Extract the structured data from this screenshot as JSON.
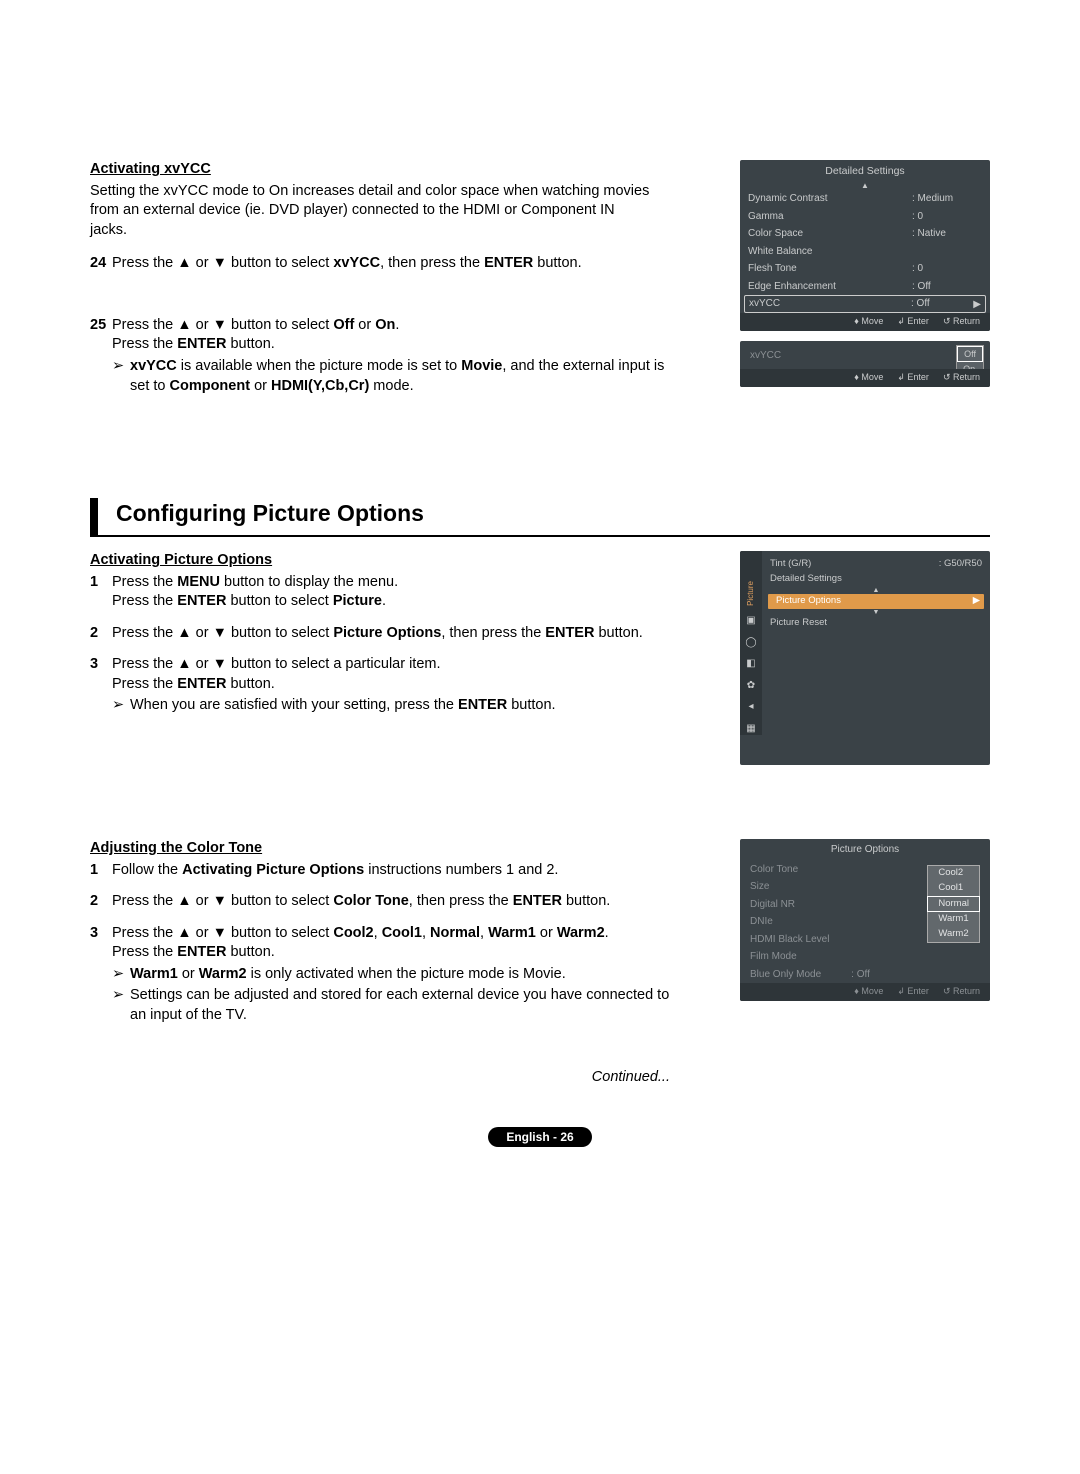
{
  "xvycc": {
    "heading": "Activating xvYCC",
    "intro": "Setting the xvYCC mode to On increases detail and color space when watching movies from an external device (ie. DVD player) connected to the HDMI or Component IN jacks.",
    "step24_num": "24",
    "step24_a": "Press the ▲ or ▼ button to select ",
    "step24_b": "xvYCC",
    "step24_c": ", then press the ",
    "step24_d": "ENTER",
    "step24_e": " button.",
    "step25_num": "25",
    "step25_line1_a": "Press the ▲ or ▼ button to select ",
    "step25_line1_b": "Off",
    "step25_line1_c": " or ",
    "step25_line1_d": "On",
    "step25_line1_e": ".",
    "step25_line2_a": "Press the ",
    "step25_line2_b": "ENTER",
    "step25_line2_c": " button.",
    "step25_note_a": "xvYCC",
    "step25_note_b": " is available when the picture mode is set to ",
    "step25_note_c": "Movie",
    "step25_note_d": ", and the external input is set to ",
    "step25_note_e": "Component",
    "step25_note_f": " or ",
    "step25_note_g": "HDMI(Y,Cb,Cr)",
    "step25_note_h": " mode."
  },
  "config": {
    "title": "Configuring Picture Options",
    "act_heading": "Activating Picture Options",
    "step1_num": "1",
    "step1_l1a": "Press the ",
    "step1_l1b": "MENU",
    "step1_l1c": " button to display the menu.",
    "step1_l2a": "Press the ",
    "step1_l2b": "ENTER",
    "step1_l2c": " button to select ",
    "step1_l2d": "Picture",
    "step1_l2e": ".",
    "step2_num": "2",
    "step2_a": "Press the ▲ or ▼ button to select ",
    "step2_b": "Picture Options",
    "step2_c": ", then press the ",
    "step2_d": "ENTER",
    "step2_e": " button.",
    "step3_num": "3",
    "step3_l1": "Press the ▲ or ▼ button to select a particular item.",
    "step3_l2a": "Press the ",
    "step3_l2b": "ENTER",
    "step3_l2c": " button.",
    "step3_note_a": "When you are satisfied with your setting, press the ",
    "step3_note_b": "ENTER",
    "step3_note_c": " button."
  },
  "color": {
    "heading": "Adjusting the Color Tone",
    "step1_num": "1",
    "step1_a": "Follow the ",
    "step1_b": "Activating Picture Options",
    "step1_c": " instructions numbers 1 and 2.",
    "step2_num": "2",
    "step2_a": "Press the ▲ or ▼ button to select ",
    "step2_b": "Color Tone",
    "step2_c": ", then press the ",
    "step2_d": "ENTER",
    "step2_e": " button.",
    "step3_num": "3",
    "step3_l1a": "Press the ▲ or ▼ button to select ",
    "step3_l1b": "Cool2",
    "step3_l1c": ", ",
    "step3_l1d": "Cool1",
    "step3_l1e": ", ",
    "step3_l1f": "Normal",
    "step3_l1g": ", ",
    "step3_l1h": "Warm1",
    "step3_l1i": " or ",
    "step3_l1j": "Warm2",
    "step3_l1k": ".",
    "step3_l2a": "Press the ",
    "step3_l2b": "ENTER",
    "step3_l2c": " button.",
    "step3_n1a": "Warm1",
    "step3_n1b": " or ",
    "step3_n1c": "Warm2",
    "step3_n1d": " is only activated when the picture mode is Movie.",
    "step3_n2": "Settings can be adjusted and stored for each external device you have connected to an input of the TV."
  },
  "continued": "Continued...",
  "footer": "English - 26",
  "osd1": {
    "title": "Detailed Settings",
    "rows": [
      {
        "k": "Dynamic Contrast",
        "v": ": Medium"
      },
      {
        "k": "Gamma",
        "v": ": 0"
      },
      {
        "k": "Color Space",
        "v": ": Native"
      },
      {
        "k": "White Balance",
        "v": ""
      },
      {
        "k": "Flesh Tone",
        "v": ": 0"
      },
      {
        "k": "Edge Enhancement",
        "v": ": Off"
      }
    ],
    "sel_k": "xvYCC",
    "sel_v": ": Off",
    "foot_move": "Move",
    "foot_enter": "Enter",
    "foot_return": "Return"
  },
  "osd1b": {
    "label": "xvYCC",
    "opt1": "Off",
    "opt2": "On"
  },
  "osd2": {
    "side_label": "Picture",
    "r1k": "Tint (G/R)",
    "r1v": ": G50/R50",
    "r2": "Detailed Settings",
    "hl": "Picture Options",
    "r4": "Picture Reset"
  },
  "osd3": {
    "title": "Picture Options",
    "list": [
      "Color Tone",
      "Size",
      "Digital NR",
      "DNIe",
      "HDMI Black Level",
      "Film Mode",
      "Blue Only Mode"
    ],
    "off": ": Off",
    "popup": [
      "Cool2",
      "Cool1",
      "Normal",
      "Warm1",
      "Warm2"
    ]
  }
}
